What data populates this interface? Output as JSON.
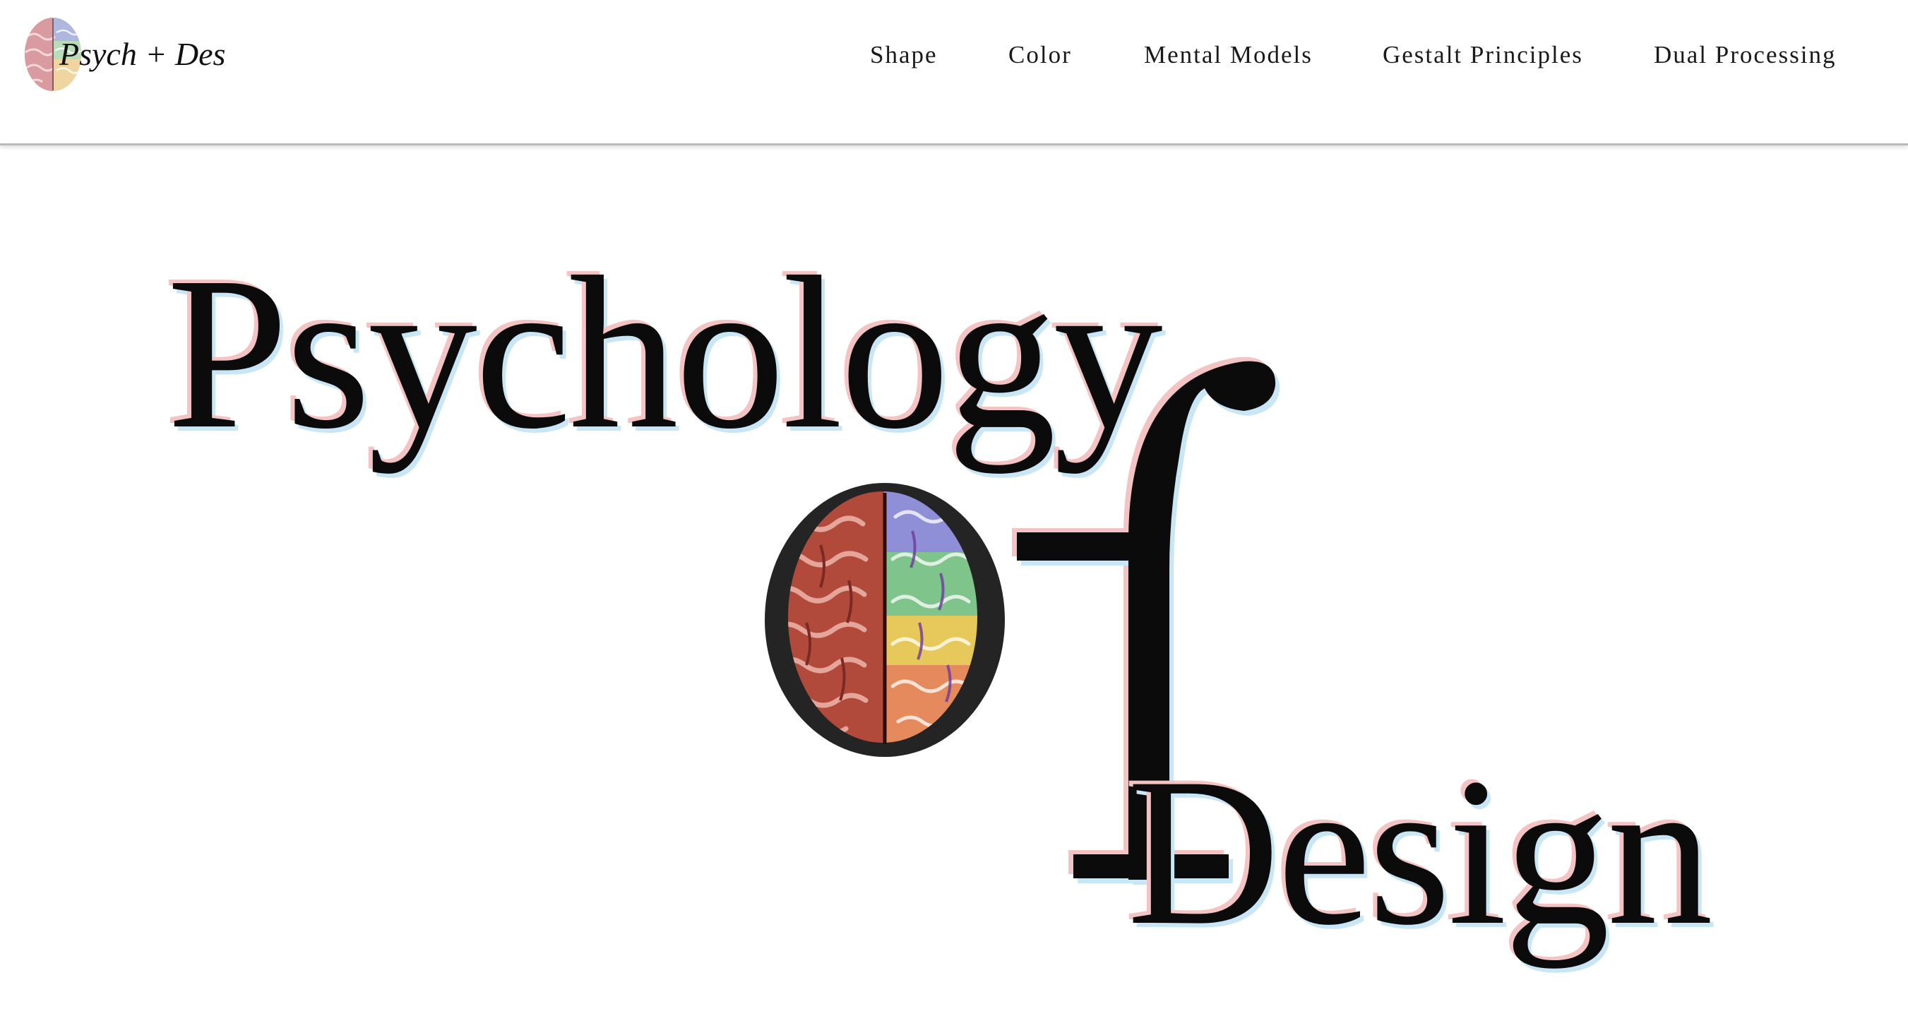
{
  "header": {
    "logo_text": "Psych + Des",
    "logo_icon": "brain-icon"
  },
  "nav": {
    "items": [
      {
        "label": "Shape"
      },
      {
        "label": "Color"
      },
      {
        "label": "Mental Models"
      },
      {
        "label": "Gestalt Principles"
      },
      {
        "label": "Dual Processing"
      }
    ]
  },
  "hero": {
    "word_top": "Psychology",
    "word_middle": "of",
    "word_bottom": "Design",
    "image_icon": "brain-icon"
  },
  "colors": {
    "text": "#0b0b0b",
    "shadow_pink": "#f4c3c3",
    "shadow_blue": "#c8e6f6",
    "brain_left": "#b24a3c",
    "circle": "#242424"
  }
}
